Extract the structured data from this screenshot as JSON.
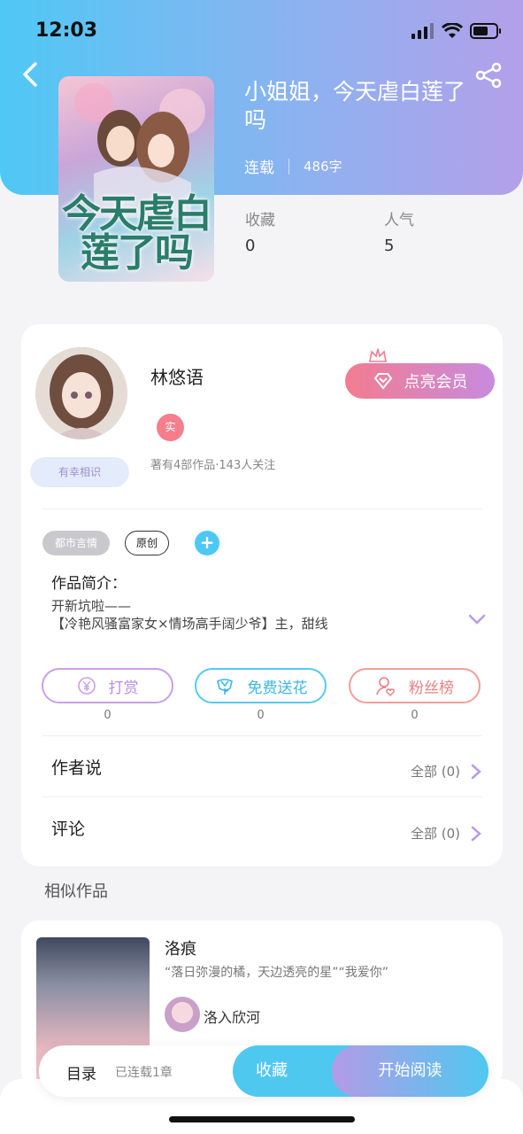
{
  "status_bar": {
    "time": "12:03"
  },
  "book": {
    "title": "小姐姐，今天虐白莲了吗",
    "cover_text": "今天虐白莲了吗",
    "status": "连载",
    "word_count": "486字",
    "stats": [
      {
        "label": "收藏",
        "value": "0"
      },
      {
        "label": "人气",
        "value": "5"
      }
    ]
  },
  "author": {
    "name": "林悠语",
    "verified_label": "实",
    "relation_badge": "有幸相识",
    "stats": "著有4部作品·143人关注",
    "vip_button": "点亮会员"
  },
  "tags": {
    "genre": "都市言情",
    "original": "原创",
    "add": "+"
  },
  "intro": {
    "heading": "作品简介：",
    "line1": "开新坑啦——",
    "line2": "【冷艳风骚富家女×情场高手阔少爷】主，甜线"
  },
  "actions": [
    {
      "label": "打赏",
      "count": "0",
      "icon": "yen-icon"
    },
    {
      "label": "免费送花",
      "count": "0",
      "icon": "flower-icon"
    },
    {
      "label": "粉丝榜",
      "count": "0",
      "icon": "fan-ranking-icon"
    }
  ],
  "author_says": {
    "label": "作者说",
    "all": "全部 (0)"
  },
  "comments": {
    "label": "评论",
    "all": "全部 (0)"
  },
  "similar": {
    "heading": "相似作品",
    "item": {
      "title": "洛痕",
      "desc": "“落日弥漫的橘，天边透亮的星”“我爱你”",
      "author": "洛入欣河"
    }
  },
  "bottom_bar": {
    "toc": "目录",
    "serial": "已连载1章",
    "collect": "收藏",
    "read": "开始阅读"
  },
  "colors": {
    "accent_blue": "#4fc8f0",
    "accent_purple": "#b39be6",
    "pink": "#f37c8f"
  }
}
